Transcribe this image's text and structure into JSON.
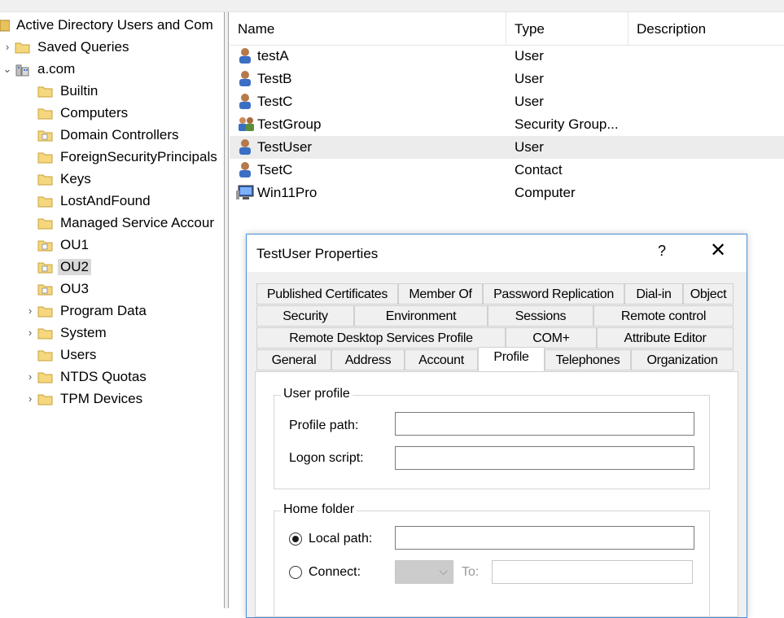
{
  "tree": {
    "root_label": "Active Directory Users and Com",
    "items": [
      {
        "label": "Saved Queries",
        "chev": "›"
      },
      {
        "label": "a.com",
        "chev": "⌄"
      },
      {
        "label": "Builtin"
      },
      {
        "label": "Computers"
      },
      {
        "label": "Domain Controllers"
      },
      {
        "label": "ForeignSecurityPrincipals"
      },
      {
        "label": "Keys"
      },
      {
        "label": "LostAndFound"
      },
      {
        "label": "Managed Service Accour"
      },
      {
        "label": "OU1"
      },
      {
        "label": "OU2"
      },
      {
        "label": "OU3"
      },
      {
        "label": "Program Data",
        "chev": "›"
      },
      {
        "label": "System",
        "chev": "›"
      },
      {
        "label": "Users"
      },
      {
        "label": "NTDS Quotas",
        "chev": "›"
      },
      {
        "label": "TPM Devices",
        "chev": "›"
      }
    ]
  },
  "list": {
    "columns": [
      "Name",
      "Type",
      "Description"
    ],
    "rows": [
      {
        "name": "testA",
        "type": "User",
        "icon": "user-icon"
      },
      {
        "name": "TestB",
        "type": "User",
        "icon": "user-icon"
      },
      {
        "name": "TestC",
        "type": "User",
        "icon": "user-icon"
      },
      {
        "name": "TestGroup",
        "type": "Security Group...",
        "icon": "group-icon"
      },
      {
        "name": "TestUser",
        "type": "User",
        "icon": "user-icon"
      },
      {
        "name": "TsetC",
        "type": "Contact",
        "icon": "contact-icon"
      },
      {
        "name": "Win11Pro",
        "type": "Computer",
        "icon": "computer-icon"
      }
    ]
  },
  "dialog": {
    "title": "TestUser Properties",
    "help": "?",
    "close": "✕",
    "tabs_row1": [
      "Published Certificates",
      "Member Of",
      "Password Replication",
      "Dial-in",
      "Object"
    ],
    "tabs_row2": [
      "Security",
      "Environment",
      "Sessions",
      "Remote control"
    ],
    "tabs_row3": [
      "Remote Desktop Services Profile",
      "COM+",
      "Attribute Editor"
    ],
    "tabs_row4": [
      "General",
      "Address",
      "Account",
      "Profile",
      "Telephones",
      "Organization"
    ],
    "profile": {
      "user_profile_legend": "User profile",
      "profile_path_label": "Profile path:",
      "logon_script_label": "Logon script:",
      "home_folder_legend": "Home folder",
      "local_path_label": "Local path:",
      "connect_label": "Connect:",
      "to_label": "To:"
    }
  },
  "colors": {
    "selection": "#d9d9d9",
    "dialog_border": "#4a90d9",
    "folder": "#f5d77e"
  }
}
